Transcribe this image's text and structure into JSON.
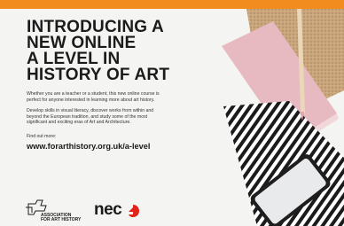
{
  "ad": {
    "headline": [
      "INTRODUCING A",
      "NEW ONLINE",
      "A LEVEL IN",
      "HISTORY OF ART"
    ],
    "paragraph_1": "Whether you are a teacher or a student, this new online course is perfect for anyone interested in learning more about art history.",
    "paragraph_2": "Develop skills in visual literacy, discover works from within and beyond the European tradition, and study some of the most significant and exciting eras of Art and Architecture.",
    "find_out": "Find out more:",
    "url": "www.forarthistory.org.uk/a-level",
    "logo_afah": [
      "ASSOCIATION",
      "FOR ART HISTORY"
    ],
    "logo_nec": "nec"
  },
  "colors": {
    "top_bar": "#f28c1f",
    "background": "#f4f4f2",
    "nec_red": "#e2231a",
    "headline": "#1b1b1b"
  },
  "icons": {
    "afah": "association-for-art-history-logo",
    "nec": "nec-logo",
    "photo": "notebooks-pencil-phone-photo"
  }
}
